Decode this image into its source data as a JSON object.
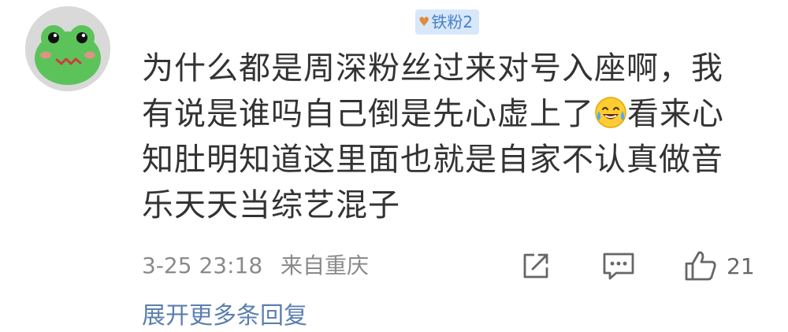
{
  "comment": {
    "author": {
      "name": "",
      "badge_label": "铁粉2",
      "badge_icon": "fan-badge-icon"
    },
    "text_segments": [
      "为什么都是周深粉丝过来对号入座啊，我有说是谁吗自己倒是先心虚上了",
      "看来心知肚明知道这里面也就是自家不认真做音乐天天当综艺混子"
    ],
    "emoji": "laugh-cry-emoji",
    "date": "3-25 23:18",
    "location": "来自重庆",
    "actions": {
      "share_icon": "share-icon",
      "reply_icon": "comment-icon",
      "like_icon": "thumbs-up-icon",
      "like_count": "21"
    },
    "more_replies_label": "展开更多条回复"
  },
  "colors": {
    "text": "#333333",
    "meta": "#8a8a8a",
    "badge_bg": "#d8e8fb",
    "badge_text": "#4a7fc9",
    "link": "#5b7fb0",
    "avatar_green": "#5cc35a"
  }
}
